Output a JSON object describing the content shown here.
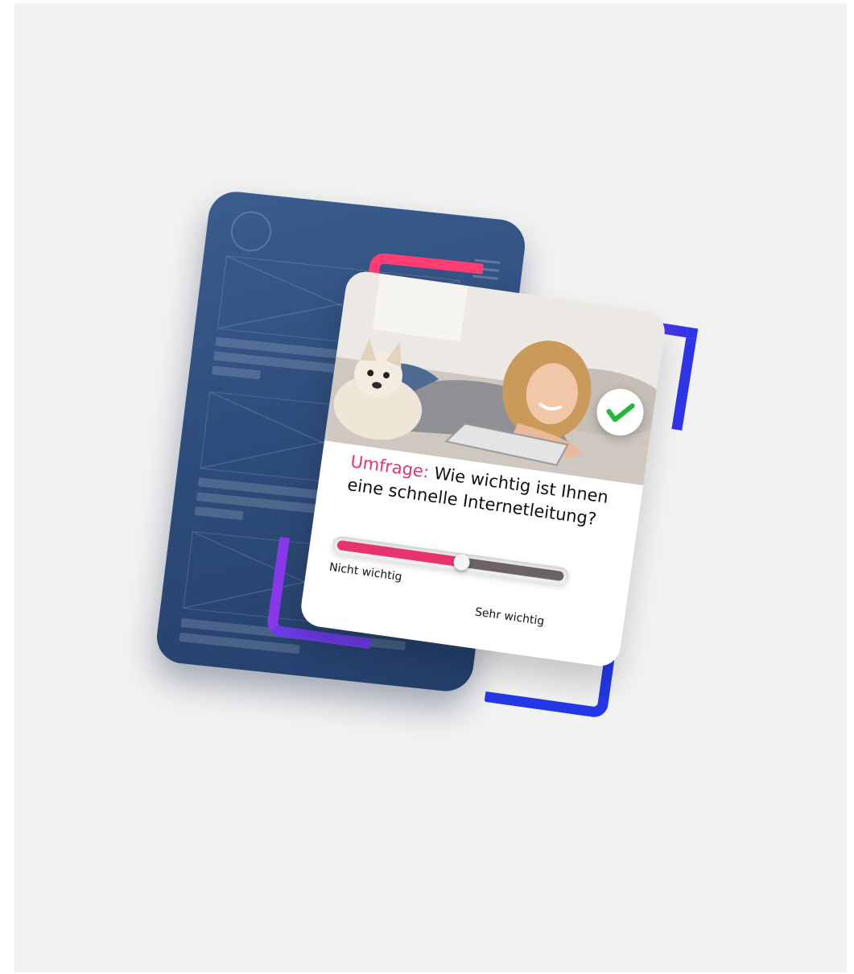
{
  "survey": {
    "prefix": "Umfrage:",
    "question": " Wie wichtig ist Ihnen eine schnelle Internetleitung?",
    "slider_value_percent": 55,
    "label_min": "Nicht wichtig",
    "label_max": "Sehr wichtig"
  },
  "icons": {
    "check_badge": "check-icon",
    "phone_menu": "hamburger-menu-icon",
    "phone_avatar": "avatar-placeholder-icon",
    "image_placeholder": "image-placeholder-icon"
  },
  "colors": {
    "accent_pink": "#e8336d",
    "phone_blue": "#2e4d7c",
    "check_green": "#22b83a",
    "bracket_purple": "#8a38ec",
    "bracket_blue": "#2438e8"
  }
}
